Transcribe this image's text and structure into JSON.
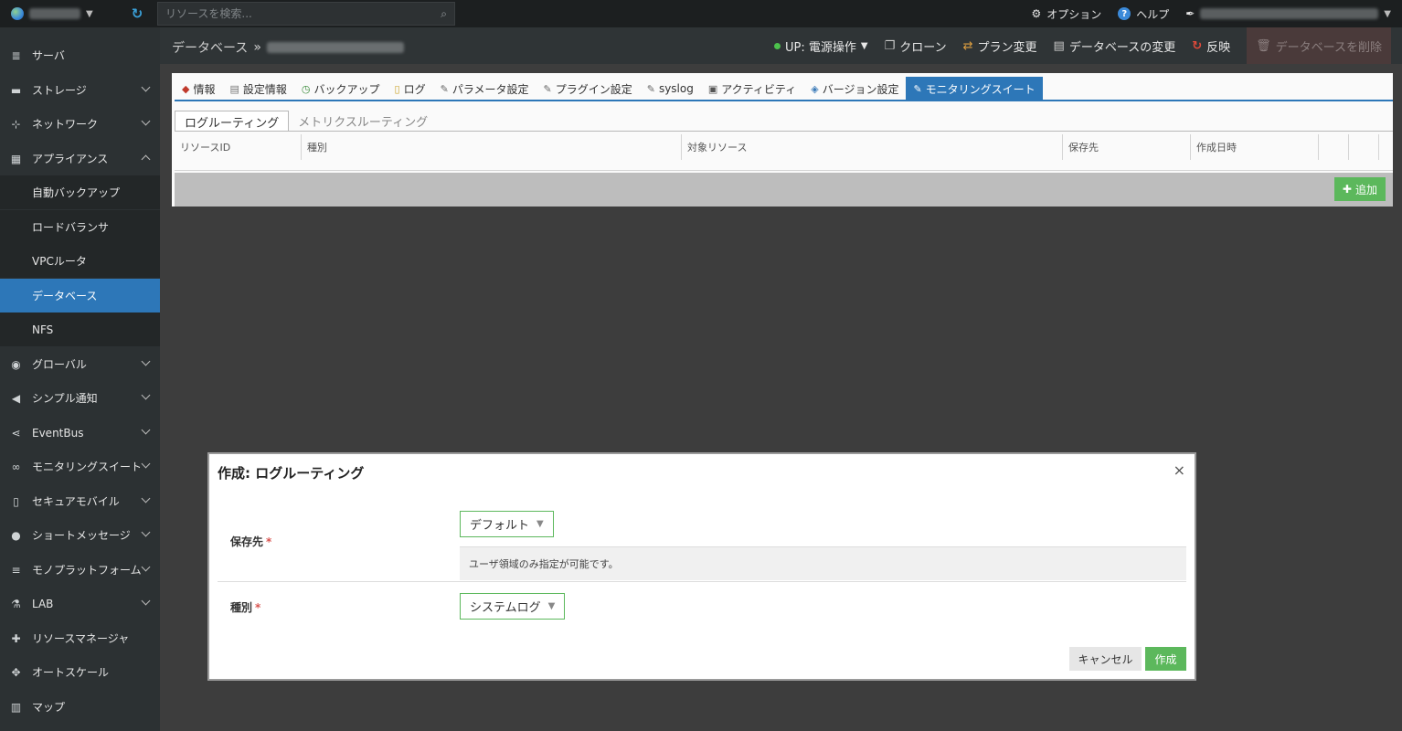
{
  "topbar": {
    "search_placeholder": "リソースを検索...",
    "options_label": "オプション",
    "help_label": "ヘルプ"
  },
  "sidebar": {
    "items": [
      {
        "label": "サーバ",
        "icon": "server-icon",
        "has_children": false
      },
      {
        "label": "ストレージ",
        "icon": "storage-icon",
        "has_children": true
      },
      {
        "label": "ネットワーク",
        "icon": "network-icon",
        "has_children": true
      },
      {
        "label": "アプライアンス",
        "icon": "appliance-icon",
        "has_children": true,
        "expanded": true
      },
      {
        "label": "自動バックアップ",
        "sub": true
      },
      {
        "label": "ロードバランサ",
        "sub": true
      },
      {
        "label": "VPCルータ",
        "sub": true
      },
      {
        "label": "データベース",
        "sub": true,
        "active": true
      },
      {
        "label": "NFS",
        "sub": true
      },
      {
        "label": "グローバル",
        "icon": "globe-icon",
        "has_children": true
      },
      {
        "label": "シンプル通知",
        "icon": "megaphone-icon",
        "has_children": true
      },
      {
        "label": "EventBus",
        "icon": "share-icon",
        "has_children": true
      },
      {
        "label": "モニタリングスイート",
        "icon": "binoculars-icon",
        "has_children": true
      },
      {
        "label": "セキュアモバイル",
        "icon": "mobile-icon",
        "has_children": true
      },
      {
        "label": "ショートメッセージ",
        "icon": "chat-icon",
        "has_children": true
      },
      {
        "label": "モノプラットフォーム",
        "icon": "list-icon",
        "has_children": true
      },
      {
        "label": "LAB",
        "icon": "flask-icon",
        "has_children": true
      },
      {
        "label": "リソースマネージャ",
        "icon": "puzzle-icon",
        "has_children": false
      },
      {
        "label": "オートスケール",
        "icon": "arrows-icon",
        "has_children": false
      },
      {
        "label": "マップ",
        "icon": "map-icon",
        "has_children": false
      }
    ]
  },
  "header": {
    "breadcrumb_root": "データベース",
    "breadcrumb_sep": "»",
    "actions": {
      "status": "UP: 電源操作",
      "clone": "クローン",
      "plan_change": "プラン変更",
      "db_change": "データベースの変更",
      "apply": "反映",
      "delete": "データベースを削除"
    }
  },
  "tabs": [
    {
      "label": "情報",
      "icon": "info-icon"
    },
    {
      "label": "設定情報",
      "icon": "settings-info-icon"
    },
    {
      "label": "バックアップ",
      "icon": "backup-icon"
    },
    {
      "label": "ログ",
      "icon": "log-icon"
    },
    {
      "label": "パラメータ設定",
      "icon": "wrench-icon"
    },
    {
      "label": "プラグイン設定",
      "icon": "wrench-icon"
    },
    {
      "label": "syslog",
      "icon": "wrench-icon"
    },
    {
      "label": "アクティビティ",
      "icon": "monitor-icon"
    },
    {
      "label": "バージョン設定",
      "icon": "version-icon"
    },
    {
      "label": "モニタリングスイート",
      "icon": "wrench-icon",
      "active": true
    }
  ],
  "subtabs": [
    {
      "label": "ログルーティング",
      "active": true
    },
    {
      "label": "メトリクスルーティング",
      "active": false
    }
  ],
  "table": {
    "columns": [
      "リソースID",
      "種別",
      "対象リソース",
      "保存先",
      "作成日時",
      "",
      ""
    ],
    "add_label": "追加"
  },
  "modal": {
    "title": "作成: ログルーティング",
    "close": "×",
    "dest_label": "保存先",
    "dest_value": "デフォルト",
    "dest_help": "ユーザ領域のみ指定が可能です。",
    "type_label": "種別",
    "type_value": "システムログ",
    "required_mark": "*",
    "cancel_label": "キャンセル",
    "create_label": "作成"
  },
  "colors": {
    "accent": "#2d77b8",
    "success": "#5cb85c",
    "required": "#d9534f"
  }
}
